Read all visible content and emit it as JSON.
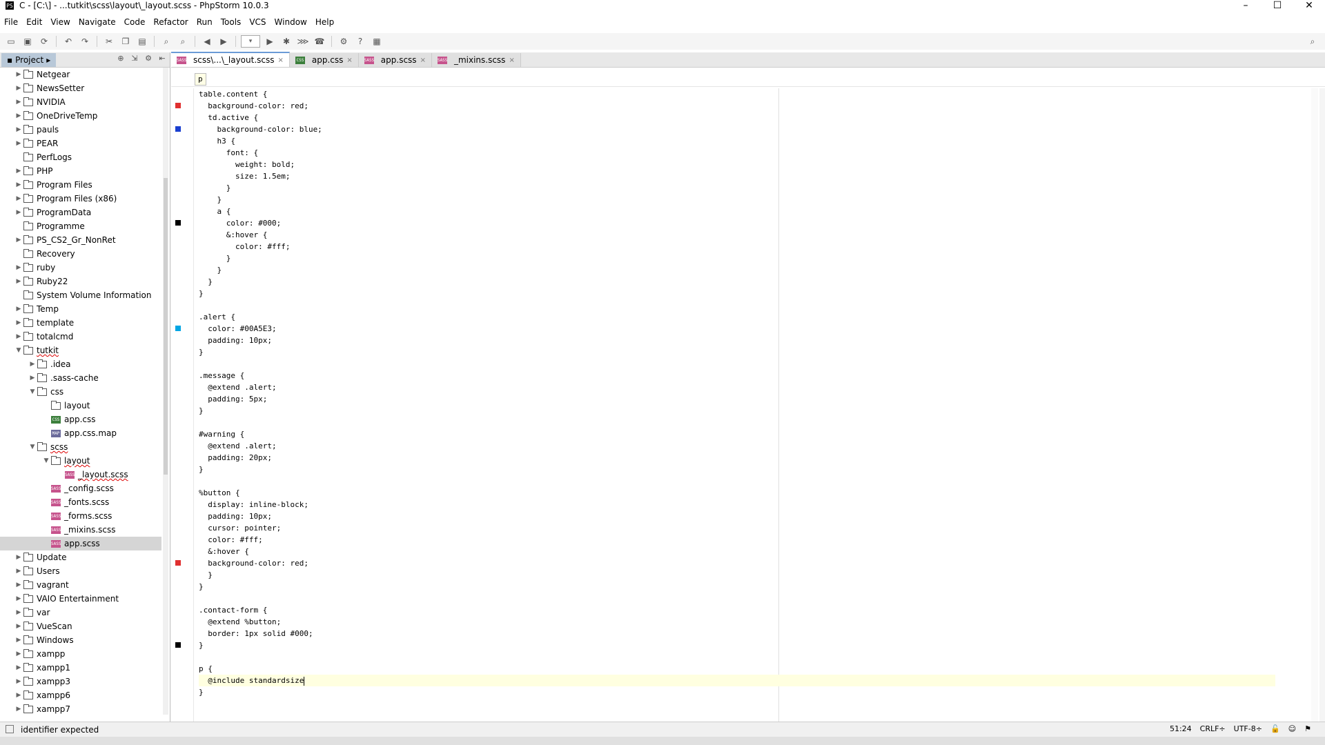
{
  "window": {
    "title": "C - [C:\\] - ...tutkit\\scss\\layout\\_layout.scss - PhpStorm 10.0.3",
    "app_icon": "PS",
    "min": "–",
    "max": "☐",
    "close": "✕"
  },
  "menu": [
    "File",
    "Edit",
    "View",
    "Navigate",
    "Code",
    "Refactor",
    "Run",
    "Tools",
    "VCS",
    "Window",
    "Help"
  ],
  "project_panel": {
    "label": "Project"
  },
  "tree": [
    {
      "label": "Netgear",
      "depth": 0,
      "arrow": "▶",
      "icon": "folder"
    },
    {
      "label": "NewsSetter",
      "depth": 0,
      "arrow": "▶",
      "icon": "folder"
    },
    {
      "label": "NVIDIA",
      "depth": 0,
      "arrow": "▶",
      "icon": "folder"
    },
    {
      "label": "OneDriveTemp",
      "depth": 0,
      "arrow": "▶",
      "icon": "folder"
    },
    {
      "label": "pauls",
      "depth": 0,
      "arrow": "▶",
      "icon": "folder"
    },
    {
      "label": "PEAR",
      "depth": 0,
      "arrow": "▶",
      "icon": "folder"
    },
    {
      "label": "PerfLogs",
      "depth": 0,
      "arrow": "",
      "icon": "folder"
    },
    {
      "label": "PHP",
      "depth": 0,
      "arrow": "▶",
      "icon": "folder"
    },
    {
      "label": "Program Files",
      "depth": 0,
      "arrow": "▶",
      "icon": "folder"
    },
    {
      "label": "Program Files (x86)",
      "depth": 0,
      "arrow": "▶",
      "icon": "folder"
    },
    {
      "label": "ProgramData",
      "depth": 0,
      "arrow": "▶",
      "icon": "folder"
    },
    {
      "label": "Programme",
      "depth": 0,
      "arrow": "",
      "icon": "folder"
    },
    {
      "label": "PS_CS2_Gr_NonRet",
      "depth": 0,
      "arrow": "▶",
      "icon": "folder"
    },
    {
      "label": "Recovery",
      "depth": 0,
      "arrow": "",
      "icon": "folder"
    },
    {
      "label": "ruby",
      "depth": 0,
      "arrow": "▶",
      "icon": "folder"
    },
    {
      "label": "Ruby22",
      "depth": 0,
      "arrow": "▶",
      "icon": "folder"
    },
    {
      "label": "System Volume Information",
      "depth": 0,
      "arrow": "",
      "icon": "folder"
    },
    {
      "label": "Temp",
      "depth": 0,
      "arrow": "▶",
      "icon": "folder"
    },
    {
      "label": "template",
      "depth": 0,
      "arrow": "▶",
      "icon": "folder"
    },
    {
      "label": "totalcmd",
      "depth": 0,
      "arrow": "▶",
      "icon": "folder"
    },
    {
      "label": "tutkit",
      "depth": 0,
      "arrow": "▼",
      "icon": "folder",
      "underline": true
    },
    {
      "label": ".idea",
      "depth": 1,
      "arrow": "▶",
      "icon": "folder"
    },
    {
      "label": ".sass-cache",
      "depth": 1,
      "arrow": "▶",
      "icon": "folder"
    },
    {
      "label": "css",
      "depth": 1,
      "arrow": "▼",
      "icon": "folder"
    },
    {
      "label": "layout",
      "depth": 2,
      "arrow": "",
      "icon": "folder"
    },
    {
      "label": "app.css",
      "depth": 2,
      "arrow": "",
      "icon": "css"
    },
    {
      "label": "app.css.map",
      "depth": 2,
      "arrow": "",
      "icon": "map"
    },
    {
      "label": "scss",
      "depth": 1,
      "arrow": "▼",
      "icon": "folder",
      "underline": true
    },
    {
      "label": "layout",
      "depth": 2,
      "arrow": "▼",
      "icon": "folder",
      "underline": true
    },
    {
      "label": "_layout.scss",
      "depth": 3,
      "arrow": "",
      "icon": "sass",
      "underline": true
    },
    {
      "label": "_config.scss",
      "depth": 2,
      "arrow": "",
      "icon": "sass"
    },
    {
      "label": "_fonts.scss",
      "depth": 2,
      "arrow": "",
      "icon": "sass"
    },
    {
      "label": "_forms.scss",
      "depth": 2,
      "arrow": "",
      "icon": "sass"
    },
    {
      "label": "_mixins.scss",
      "depth": 2,
      "arrow": "",
      "icon": "sass"
    },
    {
      "label": "app.scss",
      "depth": 2,
      "arrow": "",
      "icon": "sass",
      "selected": true
    },
    {
      "label": "Update",
      "depth": 0,
      "arrow": "▶",
      "icon": "folder"
    },
    {
      "label": "Users",
      "depth": 0,
      "arrow": "▶",
      "icon": "folder"
    },
    {
      "label": "vagrant",
      "depth": 0,
      "arrow": "▶",
      "icon": "folder"
    },
    {
      "label": "VAIO Entertainment",
      "depth": 0,
      "arrow": "▶",
      "icon": "folder"
    },
    {
      "label": "var",
      "depth": 0,
      "arrow": "▶",
      "icon": "folder"
    },
    {
      "label": "VueScan",
      "depth": 0,
      "arrow": "▶",
      "icon": "folder"
    },
    {
      "label": "Windows",
      "depth": 0,
      "arrow": "▶",
      "icon": "folder"
    },
    {
      "label": "xampp",
      "depth": 0,
      "arrow": "▶",
      "icon": "folder"
    },
    {
      "label": "xampp1",
      "depth": 0,
      "arrow": "▶",
      "icon": "folder"
    },
    {
      "label": "xampp3",
      "depth": 0,
      "arrow": "▶",
      "icon": "folder"
    },
    {
      "label": "xampp6",
      "depth": 0,
      "arrow": "▶",
      "icon": "folder"
    },
    {
      "label": "xampp7",
      "depth": 0,
      "arrow": "▶",
      "icon": "folder"
    }
  ],
  "tabs": [
    {
      "label": "scss\\...\\_layout.scss",
      "icon": "sass",
      "active": true
    },
    {
      "label": "app.css",
      "icon": "css",
      "active": false
    },
    {
      "label": "app.scss",
      "icon": "sass",
      "active": false
    },
    {
      "label": "_mixins.scss",
      "icon": "sass",
      "active": false
    }
  ],
  "tab_close": "×",
  "breadcrumb": "p",
  "code_lines": [
    "table.content {",
    "  background-color: red;",
    "  td.active {",
    "    background-color: blue;",
    "    h3 {",
    "      font: {",
    "        weight: bold;",
    "        size: 1.5em;",
    "      }",
    "    }",
    "    a {",
    "      color: #000;",
    "      &:hover {",
    "        color: #fff;",
    "      }",
    "    }",
    "  }",
    "}",
    "",
    ".alert {",
    "  color: #00A5E3;",
    "  padding: 10px;",
    "}",
    "",
    ".message {",
    "  @extend .alert;",
    "  padding: 5px;",
    "}",
    "",
    "#warning {",
    "  @extend .alert;",
    "  padding: 20px;",
    "}",
    "",
    "%button {",
    "  display: inline-block;",
    "  padding: 10px;",
    "  cursor: pointer;",
    "  color: #fff;",
    "  &:hover {",
    "  background-color: red;",
    "  }",
    "}",
    "",
    ".contact-form {",
    "  @extend %button;",
    "  border: 1px solid #000;",
    "}",
    "",
    "p {",
    "  @include standardsize",
    "}"
  ],
  "gutter_swatches": [
    {
      "line": 2,
      "color": "#e03030"
    },
    {
      "line": 4,
      "color": "#1a3fd0"
    },
    {
      "line": 12,
      "color": "#000000"
    },
    {
      "line": 21,
      "color": "#00A5E3"
    },
    {
      "line": 41,
      "color": "#e03030"
    },
    {
      "line": 48,
      "color": "#000000"
    }
  ],
  "status": {
    "message": "identifier expected",
    "position": "51:24",
    "line_sep": "CRLF÷",
    "encoding": "UTF-8÷"
  }
}
